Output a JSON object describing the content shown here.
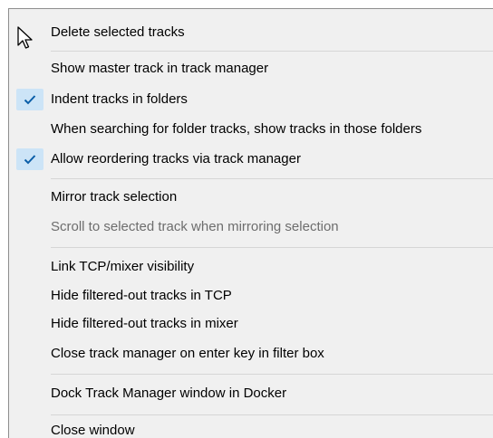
{
  "menu": {
    "items": [
      {
        "label": "Delete selected tracks",
        "checked": false,
        "enabled": true
      },
      {
        "label": "Show master track in track manager",
        "checked": false,
        "enabled": true
      },
      {
        "label": "Indent tracks in folders",
        "checked": true,
        "enabled": true
      },
      {
        "label": "When searching for folder tracks, show tracks in those folders",
        "checked": false,
        "enabled": true
      },
      {
        "label": "Allow reordering tracks via track manager",
        "checked": true,
        "enabled": true
      },
      {
        "label": "Mirror track selection",
        "checked": false,
        "enabled": true
      },
      {
        "label": "Scroll to selected track when mirroring selection",
        "checked": false,
        "enabled": false
      },
      {
        "label": "Link TCP/mixer visibility",
        "checked": false,
        "enabled": true
      },
      {
        "label": "Hide filtered-out tracks in TCP",
        "checked": false,
        "enabled": true
      },
      {
        "label": "Hide filtered-out tracks in mixer",
        "checked": false,
        "enabled": true
      },
      {
        "label": "Close track manager on enter key in filter box",
        "checked": false,
        "enabled": true
      },
      {
        "label": "Dock Track Manager window in Docker",
        "checked": false,
        "enabled": true
      },
      {
        "label": "Close window",
        "checked": false,
        "enabled": true
      }
    ]
  },
  "colors": {
    "menu_background": "#f0f0f0",
    "check_highlight": "#cce4f7",
    "check_mark": "#0a5ea8",
    "disabled_text": "#6d6d6d",
    "separator": "#d6d6d6"
  },
  "icons": {
    "cursor": "arrow-cursor-icon",
    "check": "checkmark-icon"
  }
}
